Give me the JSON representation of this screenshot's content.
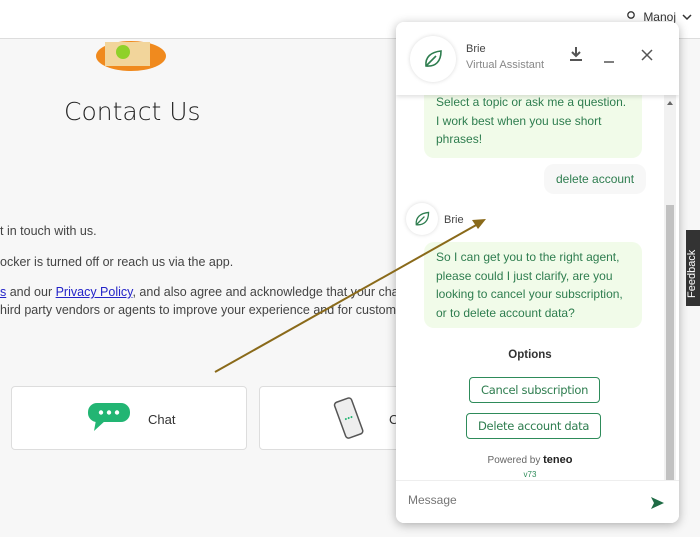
{
  "header": {
    "user_name": "Manoj"
  },
  "page": {
    "title": "Contact Us",
    "lines": [
      "t in touch with us.",
      "ocker is turned off or reach us via the app."
    ],
    "consent_prefix": "s",
    "consent_mid": " and our ",
    "privacy_link": "Privacy Policy",
    "consent_suffix": ", and also agree and acknowledge that your chats with",
    "consent_line2": "hird party vendors or agents to improve your experience and for customer servi",
    "cards": [
      {
        "label": "Chat"
      },
      {
        "label": "C"
      }
    ]
  },
  "feedback_tab": "Feedback",
  "chat": {
    "bot_name": "Brie",
    "bot_subtitle": "Virtual Assistant",
    "messages": [
      {
        "from": "bot",
        "text": "Select a topic or ask me a question. I work best when you use short phrases!"
      },
      {
        "from": "user",
        "text": "delete account"
      },
      {
        "from": "bot",
        "name": "Brie",
        "text": "So I can get you to the right agent, please could I just clarify, are you looking to cancel your subscription, or to delete account data?"
      }
    ],
    "options_title": "Options",
    "options": [
      "Cancel subscription",
      "Delete account data"
    ],
    "powered_by": "Powered by",
    "powered_brand": "teneo",
    "version": "v73",
    "input_placeholder": "Message"
  },
  "colors": {
    "accent": "#2e7d4f",
    "bot_bubble": "#f1fbe9",
    "annotation_arrow": "#8a6a1a"
  }
}
